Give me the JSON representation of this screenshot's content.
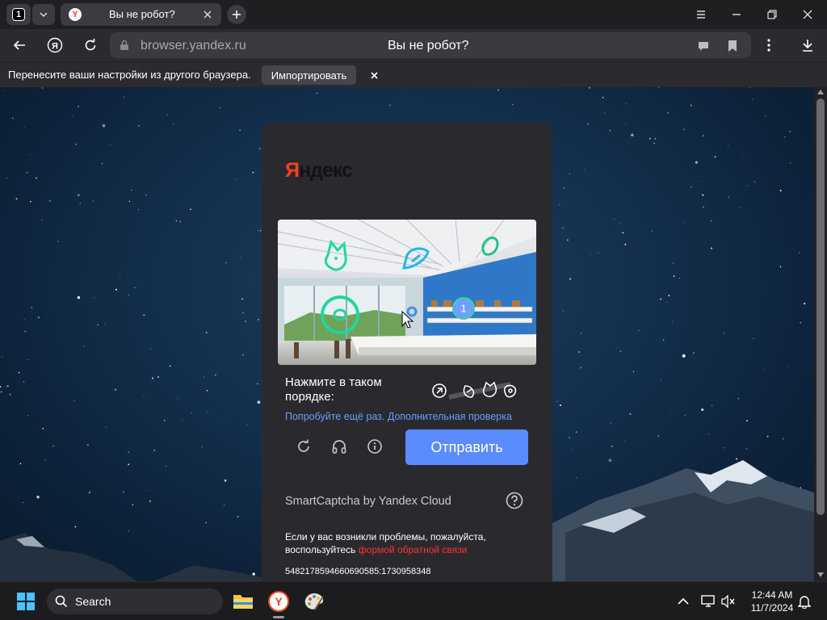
{
  "browser": {
    "tab_count": "1",
    "tab_title": "Вы не робот?",
    "favicon_letter": "Y",
    "url": "browser.yandex.ru",
    "page_title": "Вы не робот?"
  },
  "infobar": {
    "message": "Перенесите ваши настройки из другого браузера.",
    "import_label": "Импортировать",
    "close_symbol": "×"
  },
  "captcha": {
    "logo_ya": "Я",
    "logo_rest": "ндекс",
    "instruction": "Нажмите в таком порядке:",
    "retry_text": "Попробуйте ещё раз. Дополнительная проверка",
    "marker_number": "1",
    "submit_label": "Отправить",
    "brand": "SmartCaptcha by Yandex Cloud",
    "problem_text": "Если у вас возникли проблемы, пожалуйста, воспользуйтесь ",
    "problem_link": "формой обратной связи",
    "request_id": "5482178594660690585:1730958348"
  },
  "taskbar": {
    "search_label": "Search",
    "time": "12:44 AM",
    "date": "11/7/2024"
  },
  "colors": {
    "accent": "#5b8cff",
    "link": "#6b9bff",
    "yandex_red": "#fc3f1d",
    "error_link": "#ff3333"
  }
}
